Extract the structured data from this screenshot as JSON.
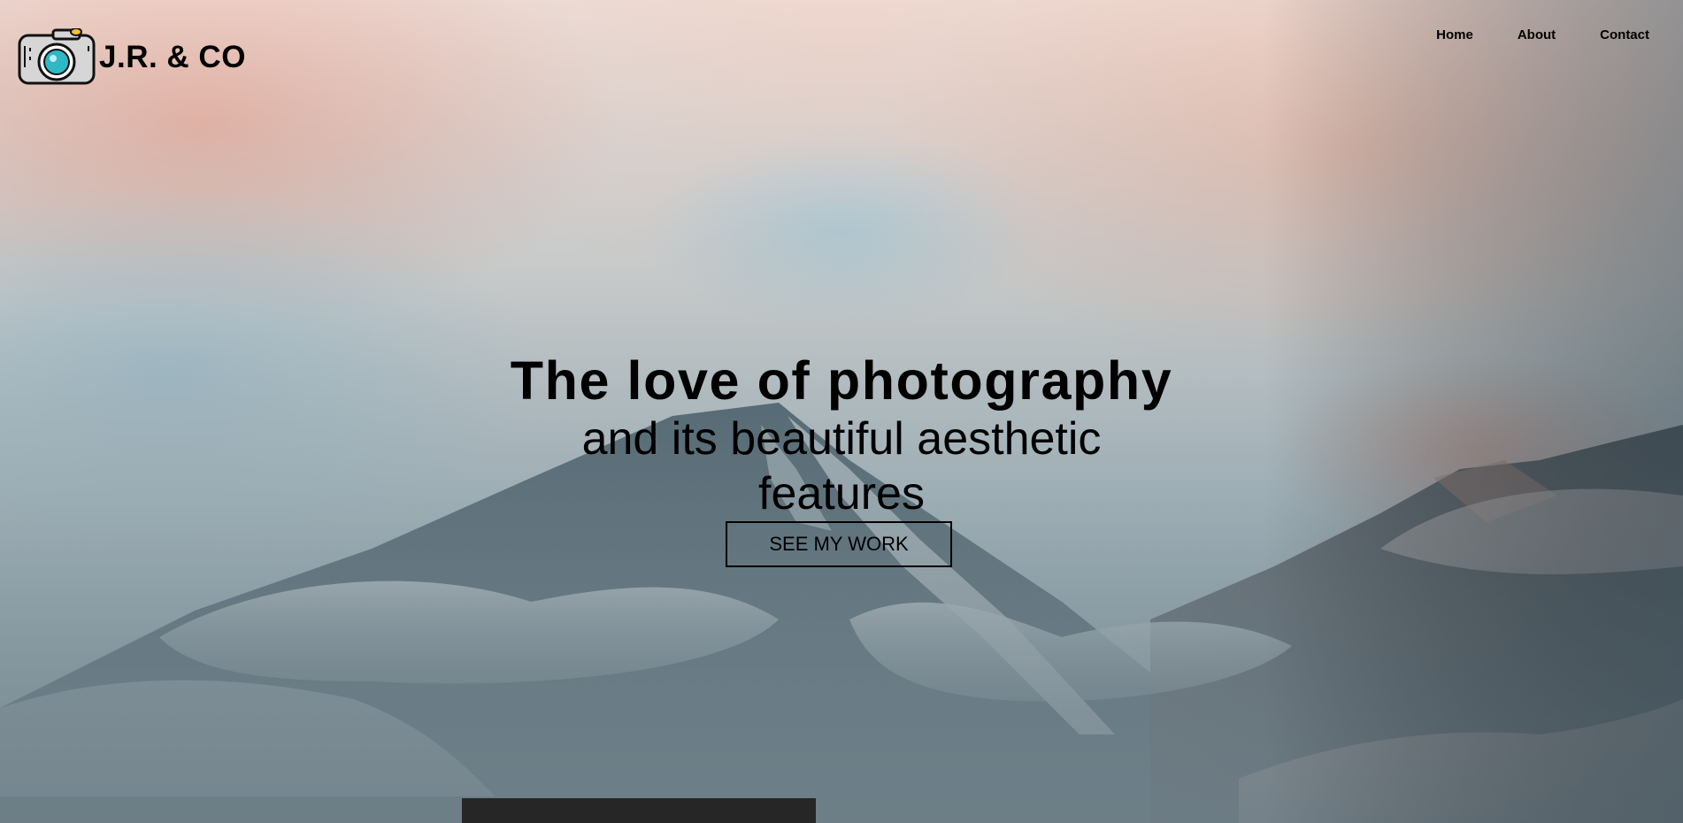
{
  "header": {
    "brand": "J.R. & CO",
    "logo_icon": "camera-icon",
    "nav": [
      {
        "label": "Home"
      },
      {
        "label": "About"
      },
      {
        "label": "Contact"
      }
    ]
  },
  "hero": {
    "title": "The love of photography",
    "subtitle": "and its beautiful aesthetic features",
    "cta_label": "SEE MY WORK",
    "background": "mountain-clouds-photo"
  },
  "colors": {
    "text": "#000000",
    "camera_lens": "#2fb8c6",
    "camera_body": "#d6d6d6",
    "shutter": "#f1c232",
    "dark_panel": "#262626"
  }
}
